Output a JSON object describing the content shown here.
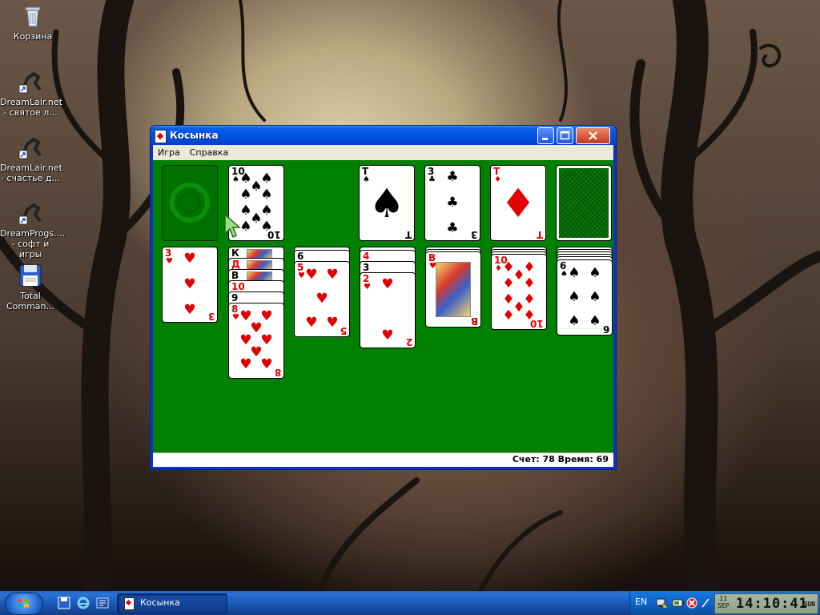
{
  "desktop": {
    "icons": [
      {
        "label": "Корзина",
        "icon": "recycle-bin-icon"
      },
      {
        "label": "DreamLair.net - святое л...",
        "icon": "shortcut-icon"
      },
      {
        "label": "DreamLair.net - счастье д...",
        "icon": "shortcut-icon"
      },
      {
        "label": "DreamProgs.... - софт и игры",
        "icon": "shortcut-icon"
      },
      {
        "label": "Total Comman...",
        "icon": "floppy-icon"
      }
    ]
  },
  "window": {
    "title": "Косынка",
    "menu": [
      "Игра",
      "Справка"
    ],
    "status": "Счет: 78 Время: 69"
  },
  "game": {
    "waste_top": {
      "rank": "10",
      "suit": "♠",
      "color": "black"
    },
    "foundations": [
      {
        "rank": "Т",
        "suit": "♠",
        "color": "black"
      },
      {
        "rank": "3",
        "suit": "♣",
        "color": "black"
      },
      {
        "rank": "Т",
        "suit": "♦",
        "color": "red"
      }
    ],
    "tableau": [
      {
        "top": {
          "rank": "3",
          "suit": "♥",
          "color": "red"
        }
      },
      {
        "run": [
          "К",
          "Д",
          "В",
          "10",
          "9"
        ],
        "top": {
          "rank": "8",
          "suit": "♥",
          "color": "red"
        }
      },
      {
        "run": [
          "6"
        ],
        "top": {
          "rank": "5",
          "suit": "♥",
          "color": "red"
        }
      },
      {
        "run": [
          "4",
          "3"
        ],
        "top": {
          "rank": "2",
          "suit": "♥",
          "color": "red"
        }
      },
      {
        "top": {
          "rank": "В",
          "suit": "♥",
          "color": "red"
        }
      },
      {
        "top": {
          "rank": "10",
          "suit": "♦",
          "color": "red"
        }
      },
      {
        "top": {
          "rank": "6",
          "suit": "♠",
          "color": "black"
        }
      }
    ]
  },
  "taskbar": {
    "task_label": "Косынка",
    "language": "EN",
    "clock_day": "11",
    "clock_month": "SEP",
    "clock_time": "14:10:41",
    "clock_weekday": "SUN"
  }
}
